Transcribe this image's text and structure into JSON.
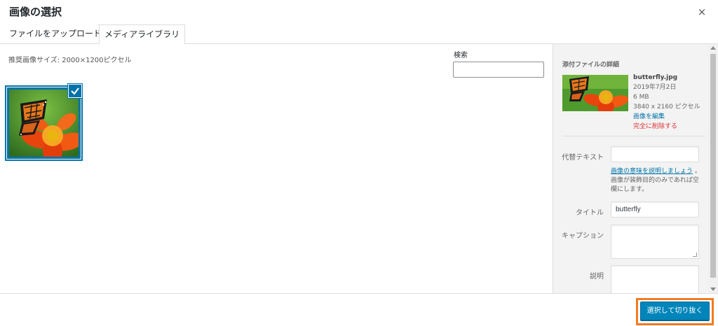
{
  "modal": {
    "title": "画像の選択",
    "close_icon": "×"
  },
  "tabs": [
    {
      "label": "ファイルをアップロード",
      "active": false
    },
    {
      "label": "メディアライブラリ",
      "active": true
    }
  ],
  "content": {
    "recommended_size": "推奨画像サイズ: 2000×1200ピクセル",
    "search_label": "検索",
    "search_value": ""
  },
  "selected_attachment": {
    "icon": "butterfly-photo",
    "selected": true
  },
  "details": {
    "heading": "添付ファイルの詳細",
    "filename": "butterfly.jpg",
    "date": "2019年7月2日",
    "filesize": "6 MB",
    "dimensions": "3840 x 2160 ピクセル",
    "edit_link": "画像を編集",
    "delete_link": "完全に削除する",
    "alt_label": "代替テキスト",
    "alt_value": "",
    "alt_help_link": "画像の意味を説明しましょう",
    "alt_help_text": "。画像が装飾目的のみであれば空欄にします。",
    "title_label": "タイトル",
    "title_value": "butterfly",
    "caption_label": "キャプション",
    "caption_value": "",
    "description_label": "説明",
    "description_value": ""
  },
  "toolbar": {
    "select_button": "選択して切り抜く"
  },
  "colors": {
    "accent": "#0073aa",
    "button": "#0085ba",
    "danger": "#dc3232",
    "highlight": "#f47b20"
  }
}
